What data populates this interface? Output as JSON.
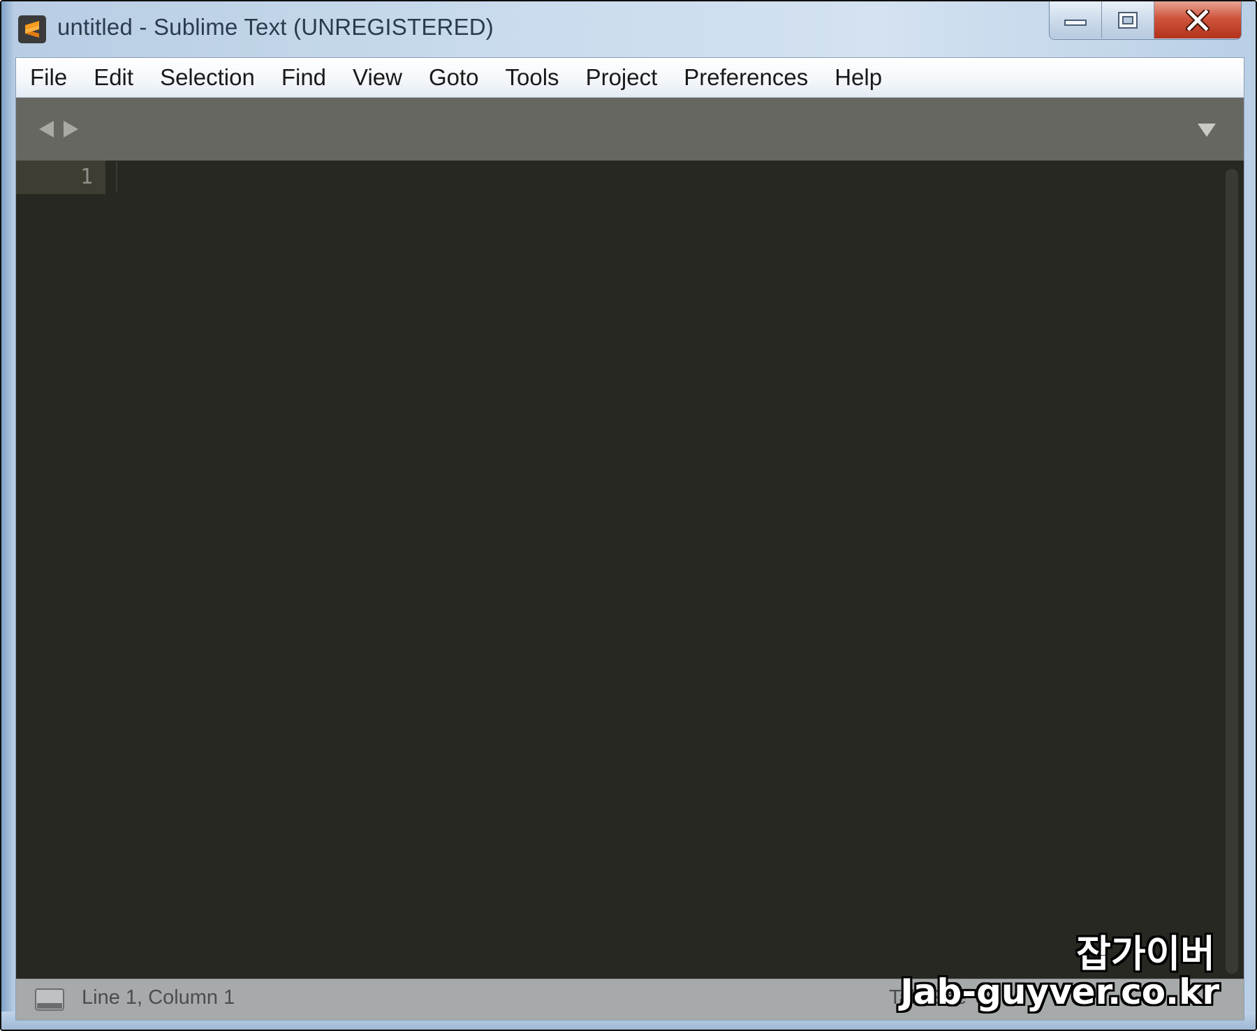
{
  "window": {
    "title": "untitled - Sublime Text (UNREGISTERED)",
    "app_icon": "sublime-text-icon",
    "buttons": {
      "minimize": "minimize-icon",
      "maximize": "maximize-icon",
      "close": "close-icon"
    }
  },
  "menubar": {
    "items": [
      {
        "label": "File"
      },
      {
        "label": "Edit"
      },
      {
        "label": "Selection"
      },
      {
        "label": "Find"
      },
      {
        "label": "View"
      },
      {
        "label": "Goto"
      },
      {
        "label": "Tools"
      },
      {
        "label": "Project"
      },
      {
        "label": "Preferences"
      },
      {
        "label": "Help"
      }
    ]
  },
  "tabbar": {
    "prev_icon": "chevron-left-icon",
    "next_icon": "chevron-right-icon",
    "menu_icon": "triangle-down-icon"
  },
  "editor": {
    "line_numbers": [
      "1"
    ],
    "content": ""
  },
  "statusbar": {
    "panel_icon": "console-panel-icon",
    "position": "Line 1, Column 1",
    "tab_size": "Tab Size"
  },
  "watermark": {
    "korean": "잡가이버",
    "domain": "Jab-guyver.co.kr"
  },
  "colors": {
    "editor_bg": "#272822",
    "gutter_active": "#3e3d32",
    "tabbar_bg": "#676762",
    "statusbar_bg": "#a7aaaa",
    "close_button": "#c8462e",
    "app_icon_accent": "#f89c1c"
  }
}
